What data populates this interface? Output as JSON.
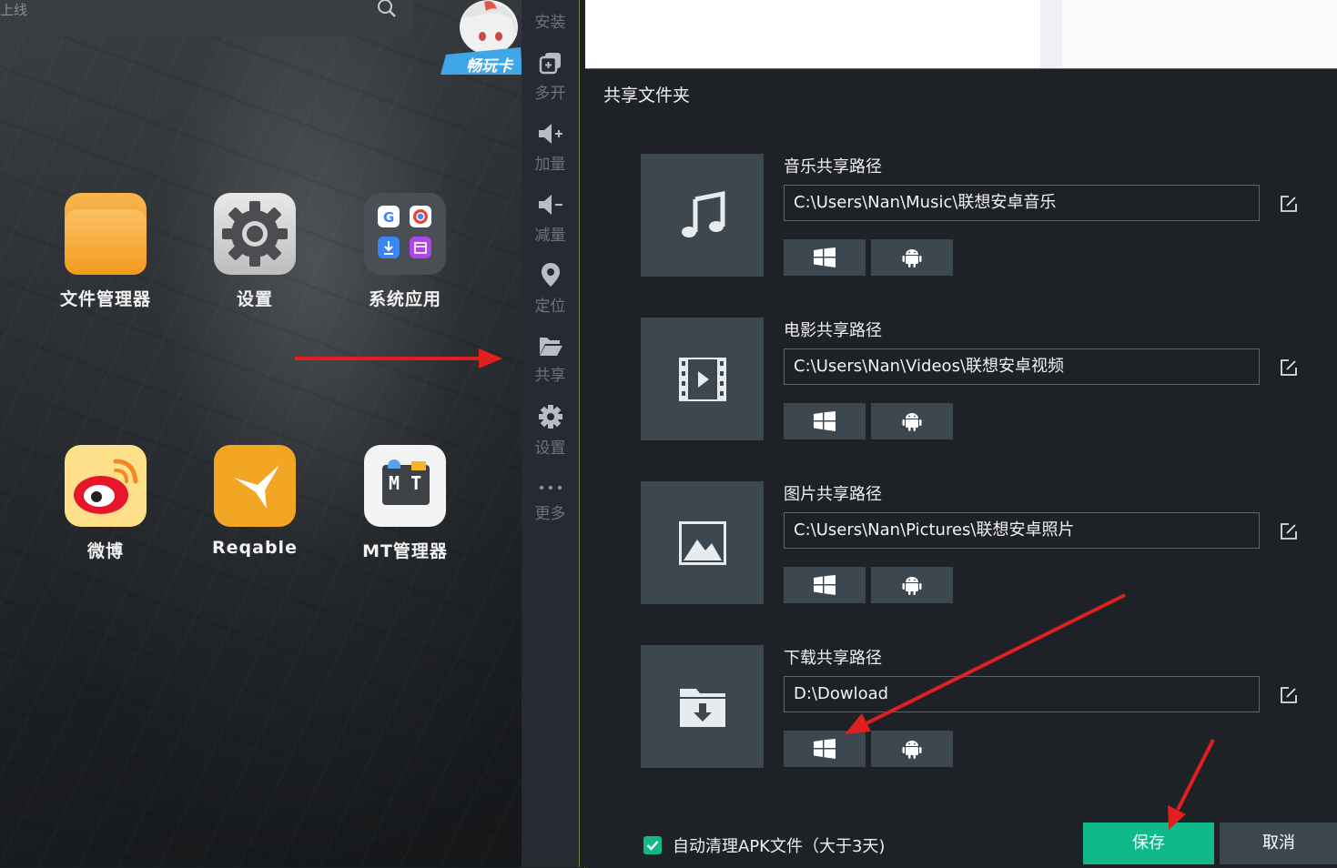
{
  "desktop": {
    "search_text": "上线",
    "mascot_label": "畅玩卡",
    "apps": [
      {
        "label": "文件管理器",
        "icon": "folder-icon"
      },
      {
        "label": "设置",
        "icon": "gear-icon"
      },
      {
        "label": "系统应用",
        "icon": "app-grid-icon"
      },
      {
        "label": "微博",
        "icon": "weibo-icon"
      },
      {
        "label": "Reqable",
        "icon": "hummingbird-icon"
      },
      {
        "label": "MT管理器",
        "icon": "mt-manager-icon"
      }
    ],
    "mt_text": "M T"
  },
  "sidebar": {
    "items": [
      {
        "label": "安装",
        "icon": "install-icon"
      },
      {
        "label": "多开",
        "icon": "multi-instance-icon"
      },
      {
        "label": "加量",
        "icon": "volume-up-icon"
      },
      {
        "label": "减量",
        "icon": "volume-down-icon"
      },
      {
        "label": "定位",
        "icon": "location-pin-icon"
      },
      {
        "label": "共享",
        "icon": "folder-open-icon"
      },
      {
        "label": "设置",
        "icon": "gear-icon"
      },
      {
        "label": "更多",
        "icon": "more-dots-icon"
      }
    ]
  },
  "dialog": {
    "title": "共享文件夹",
    "shares": [
      {
        "label": "音乐共享路径",
        "path": "C:\\Users\\Nan\\Music\\联想安卓音乐",
        "icon": "music-note-icon"
      },
      {
        "label": "电影共享路径",
        "path": "C:\\Users\\Nan\\Videos\\联想安卓视频",
        "icon": "film-icon"
      },
      {
        "label": "图片共享路径",
        "path": "C:\\Users\\Nan\\Pictures\\联想安卓照片",
        "icon": "image-icon"
      },
      {
        "label": "下载共享路径",
        "path": "D:\\Dowload",
        "icon": "download-folder-icon"
      }
    ],
    "auto_clean_label": "自动清理APK文件（大于3天)",
    "auto_clean_checked": true,
    "save_label": "保存",
    "cancel_label": "取消"
  },
  "colors": {
    "accent_green": "#10b98a",
    "panel_bg": "#1e2125",
    "tile_bg": "#3c4750",
    "annotation_red": "#e0201f"
  }
}
